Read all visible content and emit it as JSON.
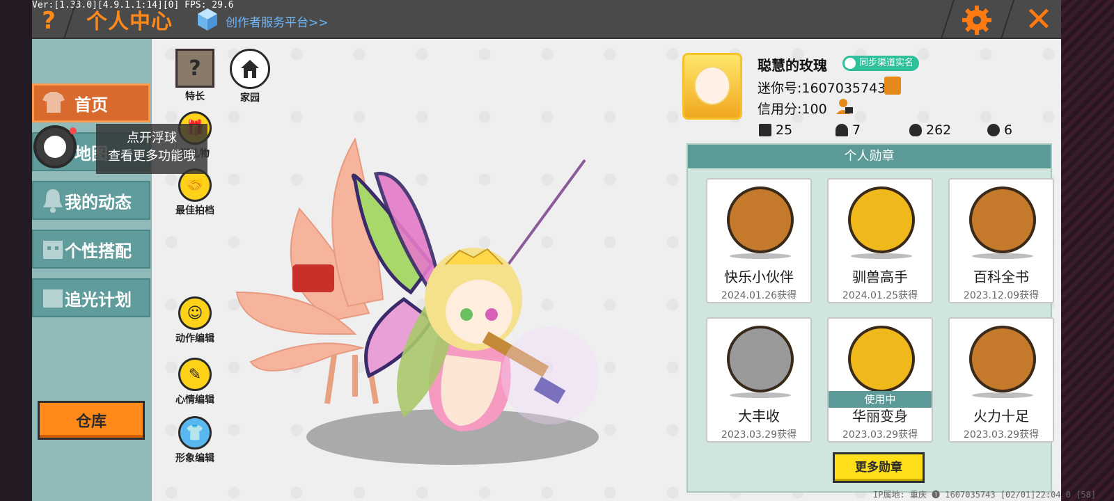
{
  "debug": {
    "version_text": "Ver:[1.33.0][4.9.1.1:14][0] FPS: 29.6"
  },
  "header": {
    "help_label": "?",
    "title": "个人中心",
    "creator_link": "创作者服务平台>>",
    "close_label": "✕"
  },
  "nav": {
    "items": [
      {
        "label": "首页",
        "active": true
      },
      {
        "label": "地图",
        "active": false
      },
      {
        "label": "我的动态",
        "active": false
      },
      {
        "label": "个性搭配",
        "active": false
      },
      {
        "label": "追光计划",
        "active": false
      }
    ],
    "warehouse": "仓库"
  },
  "float_tip": {
    "line1": "点开浮球",
    "line2": "查看更多功能哦"
  },
  "tools": {
    "talent": "特长",
    "home": "家园",
    "gift": "送礼物",
    "partner": "最佳拍档",
    "action_edit": "动作编辑",
    "mood_edit": "心情编辑",
    "image_edit": "形象编辑"
  },
  "profile": {
    "name": "聪慧的玫瑰",
    "verify_badge": "同步渠道实名",
    "uid": "迷你号:1607035743",
    "credit": "信用分:100",
    "stats": {
      "plus": "25",
      "fans": "7",
      "hot": "262",
      "likes": "6"
    }
  },
  "badges": {
    "title": "个人勋章",
    "items": [
      {
        "name": "快乐小伙伴",
        "date": "2024.01.26获得",
        "in_use": false,
        "color": "#c47a2a"
      },
      {
        "name": "驯兽高手",
        "date": "2024.01.25获得",
        "in_use": false,
        "color": "#f0b81a"
      },
      {
        "name": "百科全书",
        "date": "2023.12.09获得",
        "in_use": false,
        "color": "#c47a2a"
      },
      {
        "name": "大丰收",
        "date": "2023.03.29获得",
        "in_use": false,
        "color": "#9a9a9a"
      },
      {
        "name": "华丽变身",
        "date": "2023.03.29获得",
        "in_use": true,
        "in_use_label": "使用中",
        "color": "#f0b81a"
      },
      {
        "name": "火力十足",
        "date": "2023.03.29获得",
        "in_use": false,
        "color": "#c47a2a"
      }
    ],
    "more_button": "更多勋章"
  },
  "footer": {
    "text": "IP属地: 重庆 ❶    1607035743    [02/01]22:04 0  [58]"
  },
  "colors": {
    "accent": "#ff8a1a",
    "teal": "#5b9a96",
    "yellow": "#ffdf1a"
  }
}
